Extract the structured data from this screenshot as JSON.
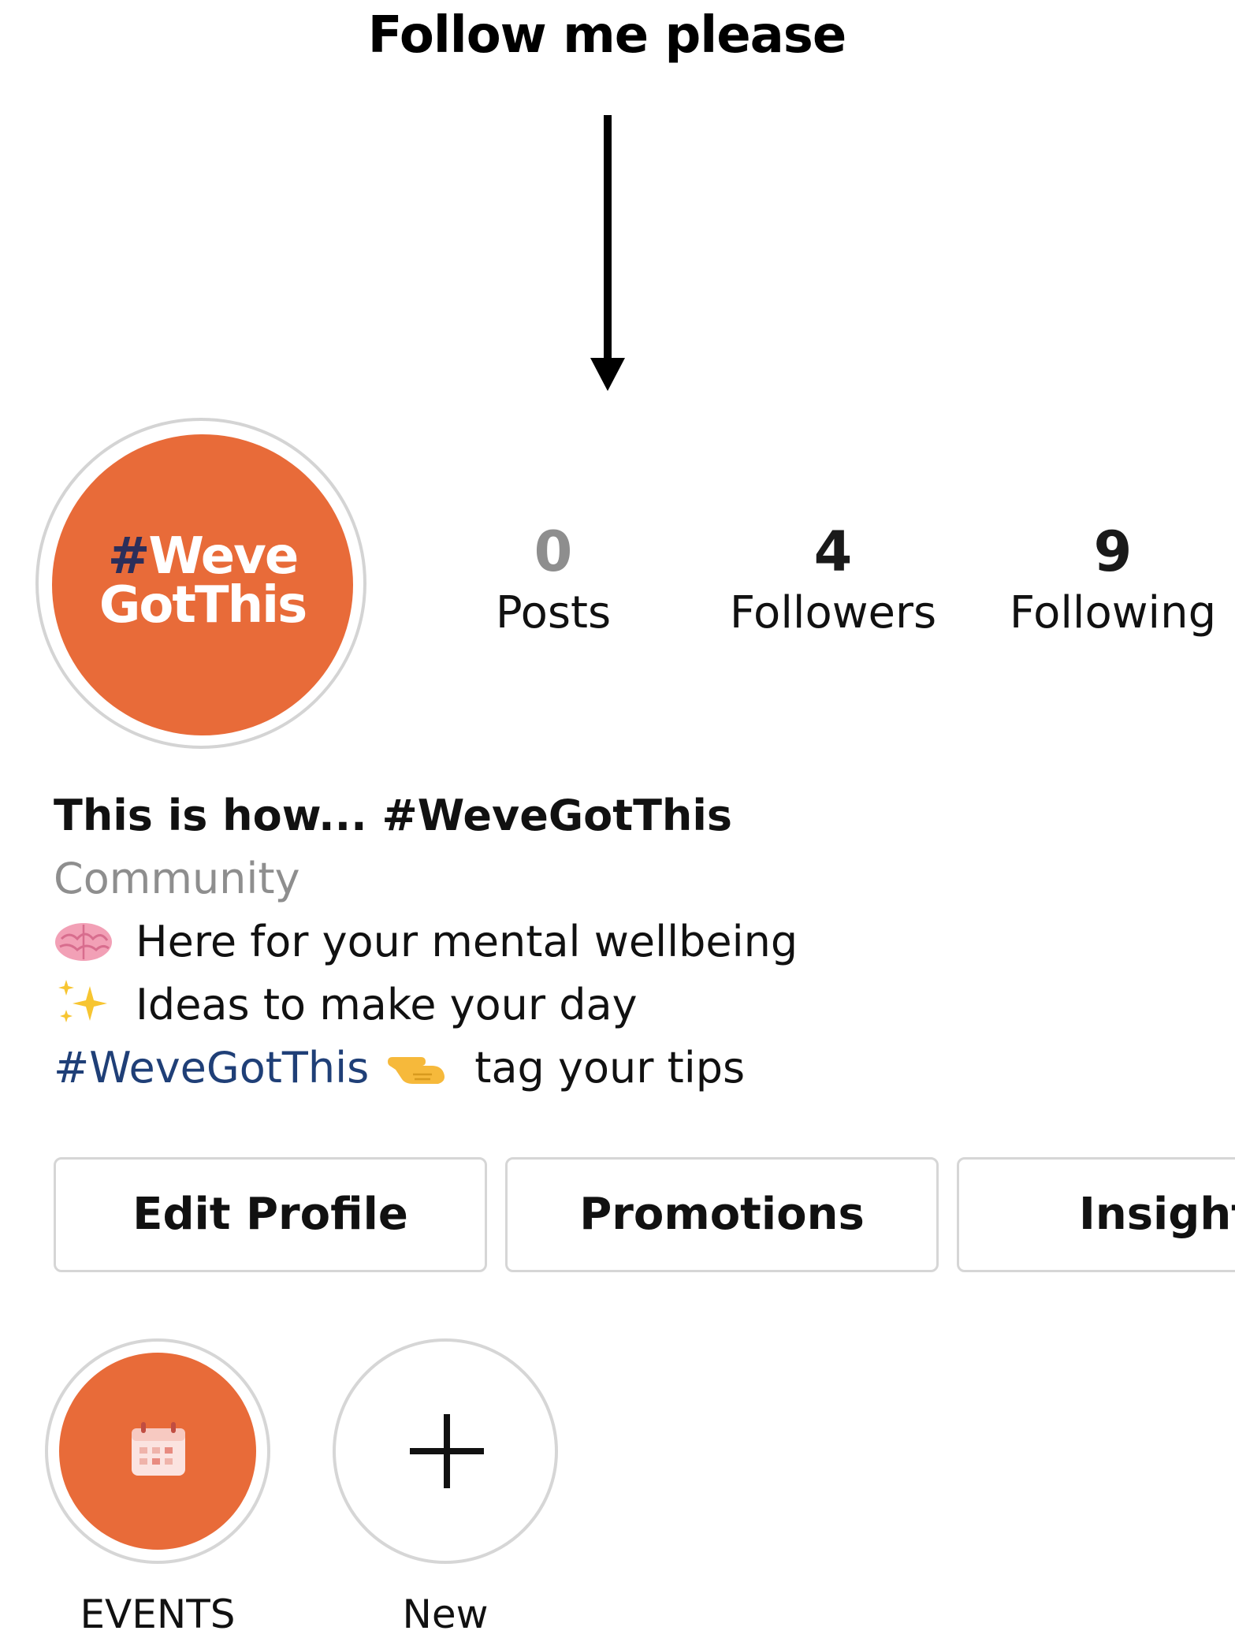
{
  "annotation": {
    "title": "Follow me please"
  },
  "profile": {
    "avatar_text_hash": "#",
    "avatar_text_line1": "Weve",
    "avatar_text_line2": "GotThis",
    "avatar_color": "#e86b39"
  },
  "stats": [
    {
      "value": "0",
      "label": "Posts"
    },
    {
      "value": "4",
      "label": "Followers"
    },
    {
      "value": "9",
      "label": "Following"
    }
  ],
  "bio": {
    "name": "This is how... #WeveGotThis",
    "category": "Community",
    "line1_icon": "brain-icon",
    "line1_text": "Here for your mental wellbeing",
    "line2_icon": "sparkles-icon",
    "line2_text": "Ideas to make your day",
    "line3_hashtag": "#WeveGotThis",
    "line3_icon": "pointing-hand-icon",
    "line3_text": "tag your tips",
    "hashtag_color": "#1f3f77"
  },
  "buttons": {
    "edit_profile": "Edit Profile",
    "promotions": "Promotions",
    "insights": "Insights"
  },
  "highlights": [
    {
      "label": "EVENTS",
      "icon": "calendar-icon"
    },
    {
      "label": "New",
      "icon": "plus-icon"
    }
  ]
}
